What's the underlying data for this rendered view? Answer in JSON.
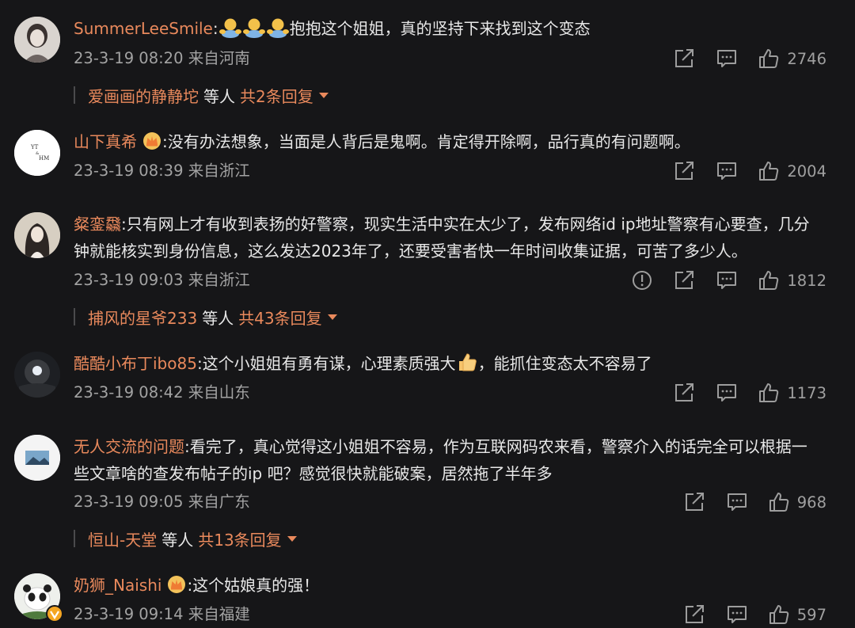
{
  "colors": {
    "background": "#161618",
    "username": "#e9895c",
    "text": "#e8e8e8",
    "meta": "#a3a3a3",
    "icon": "#9d9d9d"
  },
  "comments": [
    {
      "user": "SummerLeeSmile",
      "sep": ":",
      "text": "抱抱这个姐姐，真的坚持下来找到这个变态",
      "inline_icons": [
        "hug-emoji",
        "hug-emoji",
        "hug-emoji"
      ],
      "time": "23-3-19 08:20",
      "location": "来自河南",
      "likes": "2746",
      "replies": {
        "name": "爱画画的静静坨",
        "mid": "等人",
        "count": "共2条回复"
      }
    },
    {
      "user": "山下真希",
      "badge": "crown-badge-icon",
      "sep": ":",
      "text": "没有办法想象，当面是人背后是鬼啊。肯定得开除啊，品行真的有问题啊。",
      "time": "23-3-19 08:39",
      "location": "来自浙江",
      "likes": "2004",
      "avatar_text": [
        "YT",
        "&",
        "HM"
      ]
    },
    {
      "user": "粲銮飝",
      "sep": ":",
      "text": "只有网上才有收到表扬的好警察，现实生活中实在太少了，发布网络id ip地址警察有心要查，几分",
      "text2": "钟就能核实到身份信息，这么发达2023年了，还要受害者快一年时间收集证据，可苦了多少人。",
      "time": "23-3-19 09:03",
      "location": "来自浙江",
      "likes": "1812",
      "replies": {
        "name": "捕风的星爷233",
        "mid": "等人",
        "count": "共43条回复"
      }
    },
    {
      "user": "酷酷小布丁ibo85",
      "sep": ":",
      "text": "这个小姐姐有勇有谋，心理素质强大",
      "text_after": "，能抓住变态太不容易了",
      "inline_icons": [
        "thumbs-up-emoji"
      ],
      "time": "23-3-19 08:42",
      "location": "来自山东",
      "likes": "1173"
    },
    {
      "user": "无人交流的问题",
      "sep": ":",
      "text": "看完了，真心觉得这小姐姐不容易，作为互联网码农来看，警察介入的话完全可以根据一",
      "text2": "些文章啥的查发布帖子的ip 吧？感觉很快就能破案，居然拖了半年多",
      "time": "23-3-19 09:05",
      "location": "来自广东",
      "likes": "968",
      "replies": {
        "name": "恒山-天堂",
        "mid": "等人",
        "count": "共13条回复"
      }
    },
    {
      "user": "奶狮_Naishi",
      "badge": "crown-badge-icon",
      "sep": ":",
      "text": "这个姑娘真的强！",
      "time": "23-3-19 09:14",
      "location": "来自福建",
      "likes": "597"
    }
  ]
}
